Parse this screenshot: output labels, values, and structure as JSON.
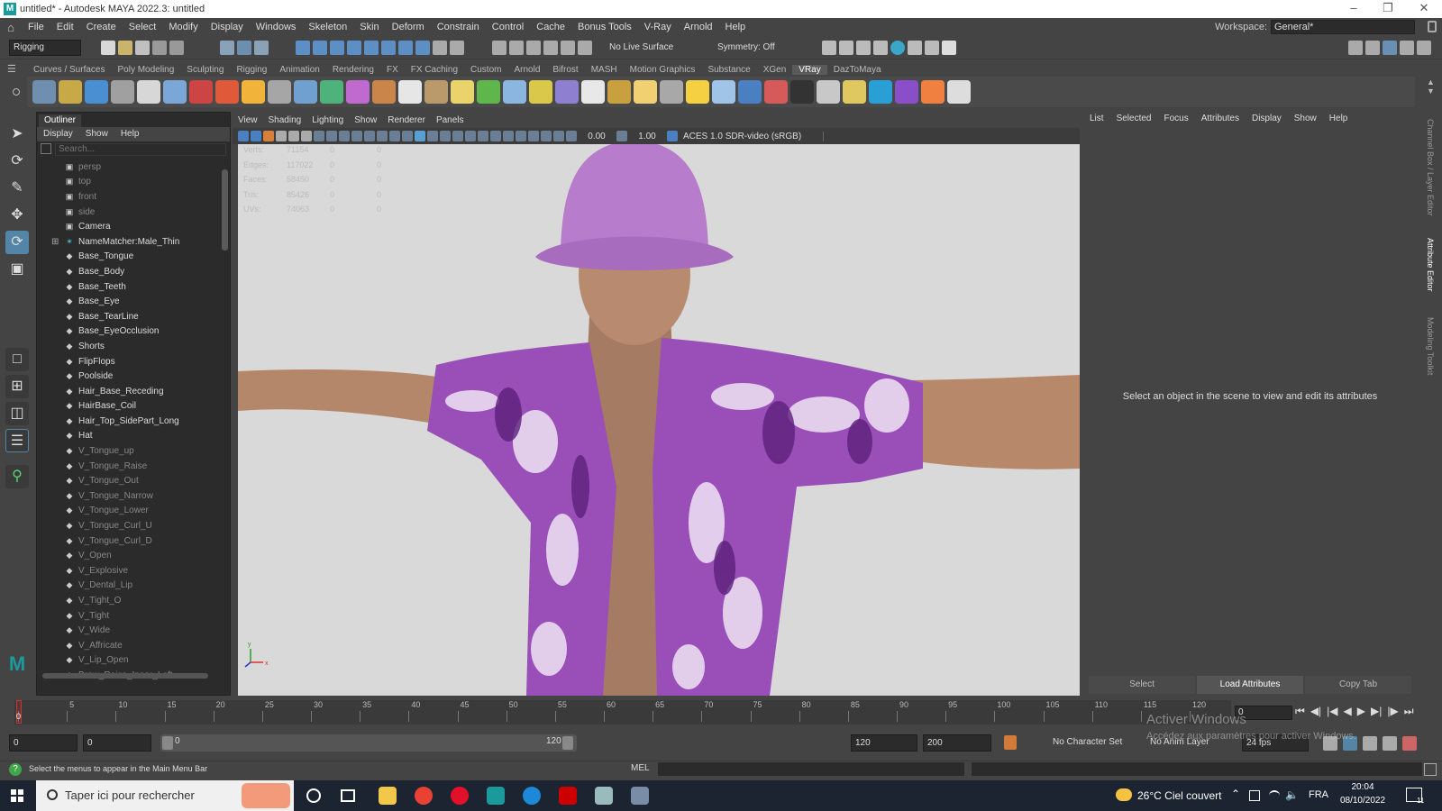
{
  "window": {
    "title": "untitled* - Autodesk MAYA 2022.3: untitled"
  },
  "menubar": {
    "items": [
      "File",
      "Edit",
      "Create",
      "Select",
      "Modify",
      "Display",
      "Windows",
      "Skeleton",
      "Skin",
      "Deform",
      "Constrain",
      "Control",
      "Cache",
      "Bonus Tools",
      "V-Ray",
      "Arnold",
      "Help"
    ],
    "workspace_label": "Workspace:",
    "workspace_value": "General*"
  },
  "statusline": {
    "mode": "Rigging",
    "live_surface": "No Live Surface",
    "symmetry": "Symmetry: Off"
  },
  "shelf": {
    "tabs": [
      "Curves / Surfaces",
      "Poly Modeling",
      "Sculpting",
      "Rigging",
      "Animation",
      "Rendering",
      "FX",
      "FX Caching",
      "Custom",
      "Arnold",
      "Bifrost",
      "MASH",
      "Motion Graphics",
      "Substance",
      "XGen",
      "VRay",
      "DazToMaya"
    ],
    "active_tab": "VRay"
  },
  "outliner": {
    "title": "Outliner",
    "menu": [
      "Display",
      "Show",
      "Help"
    ],
    "search_placeholder": "Search...",
    "items": [
      {
        "label": "persp",
        "icon": "camera-icon",
        "dim": true
      },
      {
        "label": "top",
        "icon": "camera-icon",
        "dim": true
      },
      {
        "label": "front",
        "icon": "camera-icon",
        "dim": true
      },
      {
        "label": "side",
        "icon": "camera-icon",
        "dim": true
      },
      {
        "label": "Camera",
        "icon": "camera-icon",
        "dim": false
      },
      {
        "label": "NameMatcher:Male_Thin",
        "icon": "joint-icon",
        "dim": false
      },
      {
        "label": "Base_Tongue",
        "icon": "mesh-icon",
        "dim": false
      },
      {
        "label": "Base_Body",
        "icon": "mesh-icon",
        "dim": false
      },
      {
        "label": "Base_Teeth",
        "icon": "mesh-icon",
        "dim": false
      },
      {
        "label": "Base_Eye",
        "icon": "mesh-icon",
        "dim": false
      },
      {
        "label": "Base_TearLine",
        "icon": "mesh-icon",
        "dim": false
      },
      {
        "label": "Base_EyeOcclusion",
        "icon": "mesh-icon",
        "dim": false
      },
      {
        "label": "Shorts",
        "icon": "mesh-icon",
        "dim": false
      },
      {
        "label": "FlipFlops",
        "icon": "mesh-icon",
        "dim": false
      },
      {
        "label": "Poolside",
        "icon": "mesh-icon",
        "dim": false
      },
      {
        "label": "Hair_Base_Receding",
        "icon": "mesh-icon",
        "dim": false
      },
      {
        "label": "HairBase_Coil",
        "icon": "mesh-icon",
        "dim": false
      },
      {
        "label": "Hair_Top_SidePart_Long",
        "icon": "mesh-icon",
        "dim": false
      },
      {
        "label": "Hat",
        "icon": "mesh-icon",
        "dim": false
      },
      {
        "label": "V_Tongue_up",
        "icon": "mesh-icon",
        "dim": true
      },
      {
        "label": "V_Tongue_Raise",
        "icon": "mesh-icon",
        "dim": true
      },
      {
        "label": "V_Tongue_Out",
        "icon": "mesh-icon",
        "dim": true
      },
      {
        "label": "V_Tongue_Narrow",
        "icon": "mesh-icon",
        "dim": true
      },
      {
        "label": "V_Tongue_Lower",
        "icon": "mesh-icon",
        "dim": true
      },
      {
        "label": "V_Tongue_Curl_U",
        "icon": "mesh-icon",
        "dim": true
      },
      {
        "label": "V_Tongue_Curl_D",
        "icon": "mesh-icon",
        "dim": true
      },
      {
        "label": "V_Open",
        "icon": "mesh-icon",
        "dim": true
      },
      {
        "label": "V_Explosive",
        "icon": "mesh-icon",
        "dim": true
      },
      {
        "label": "V_Dental_Lip",
        "icon": "mesh-icon",
        "dim": true
      },
      {
        "label": "V_Tight_O",
        "icon": "mesh-icon",
        "dim": true
      },
      {
        "label": "V_Tight",
        "icon": "mesh-icon",
        "dim": true
      },
      {
        "label": "V_Wide",
        "icon": "mesh-icon",
        "dim": true
      },
      {
        "label": "V_Affricate",
        "icon": "mesh-icon",
        "dim": true
      },
      {
        "label": "V_Lip_Open",
        "icon": "mesh-icon",
        "dim": true
      },
      {
        "label": "Brow_Raise_Inner_Left",
        "icon": "mesh-icon",
        "dim": true
      }
    ]
  },
  "viewport": {
    "menu": [
      "View",
      "Shading",
      "Lighting",
      "Show",
      "Renderer",
      "Panels"
    ],
    "exposure": "0.00",
    "gamma": "1.00",
    "color_space": "ACES 1.0 SDR-video (sRGB)",
    "hud": [
      {
        "label": "Verts:",
        "v1": "71154",
        "v2": "0",
        "v3": "0"
      },
      {
        "label": "Edges:",
        "v1": "117022",
        "v2": "0",
        "v3": "0"
      },
      {
        "label": "Faces:",
        "v1": "58450",
        "v2": "0",
        "v3": "0"
      },
      {
        "label": "Tris:",
        "v1": "85426",
        "v2": "0",
        "v3": "0"
      },
      {
        "label": "UVs:",
        "v1": "74063",
        "v2": "0",
        "v3": "0"
      }
    ],
    "axis_x": "x",
    "axis_y": "y"
  },
  "attribute_editor": {
    "menu": [
      "List",
      "Selected",
      "Focus",
      "Attributes",
      "Display",
      "Show",
      "Help"
    ],
    "message": "Select an object in the scene to view and edit its attributes",
    "buttons": [
      "Select",
      "Load Attributes",
      "Copy Tab"
    ]
  },
  "side_tabs": [
    "Channel Box / Layer Editor",
    "Attribute Editor",
    "Modeling Toolkit"
  ],
  "timeslider": {
    "ticks": [
      "0",
      "5",
      "10",
      "15",
      "20",
      "25",
      "30",
      "35",
      "40",
      "45",
      "50",
      "55",
      "60",
      "65",
      "70",
      "75",
      "80",
      "85",
      "90",
      "95",
      "100",
      "105",
      "110",
      "115",
      "120"
    ],
    "current_frame": "0"
  },
  "rangeslider": {
    "start": "0",
    "playback_start": "0",
    "range_start": "0",
    "range_end": "120",
    "playback_end": "120",
    "end": "200",
    "character_set": "No Character Set",
    "anim_layer": "No Anim Layer",
    "fps": "24 fps"
  },
  "watermark": {
    "line1": "Activer Windows",
    "line2": "Accédez aux paramètres pour activer Windows."
  },
  "helpline": {
    "text": "Select the menus to appear in the Main Menu Bar",
    "mel": "MEL"
  },
  "taskbar": {
    "search": "Taper ici pour rechercher",
    "weather": "26°C  Ciel couvert",
    "lang": "FRA",
    "time": "20:04",
    "date": "08/10/2022",
    "notifications": "11"
  }
}
